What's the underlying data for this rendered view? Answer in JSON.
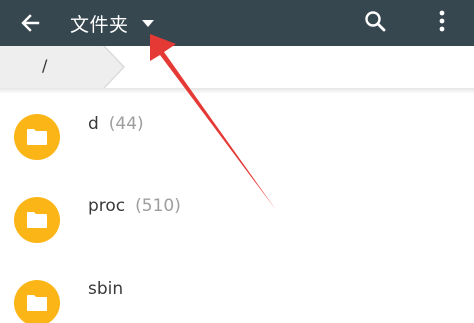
{
  "toolbar": {
    "title": "文件夹",
    "back_icon": "arrow-back-icon",
    "dropdown_icon": "caret-down-icon",
    "search_icon": "search-icon",
    "more_icon": "more-vertical-icon",
    "background_color": "#37474f"
  },
  "breadcrumb": {
    "items": [
      {
        "label": "/"
      }
    ]
  },
  "files": [
    {
      "name": "d",
      "count": "(44)"
    },
    {
      "name": "proc",
      "count": "(510)"
    },
    {
      "name": "sbin",
      "count": ""
    }
  ],
  "folder_icon": "folder-icon",
  "folder_color": "#fbb516",
  "annotation": {
    "type": "arrow",
    "color": "#e53935"
  }
}
